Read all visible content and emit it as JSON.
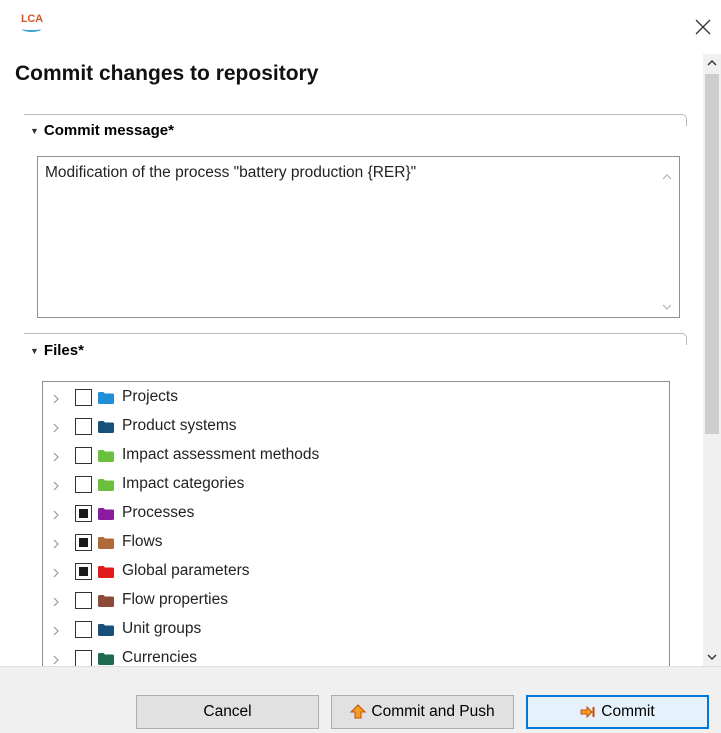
{
  "app": {
    "logo_text": "LCA"
  },
  "dialog": {
    "title": "Commit changes to repository"
  },
  "commit_message": {
    "header": "Commit message*",
    "value": "Modification of the process \"battery production {RER}\""
  },
  "files": {
    "header": "Files*",
    "items": [
      {
        "label": "Projects",
        "checked": "unchecked",
        "folder_color": "#1e90d8"
      },
      {
        "label": "Product systems",
        "checked": "unchecked",
        "folder_color": "#17507a"
      },
      {
        "label": "Impact assessment methods",
        "checked": "unchecked",
        "folder_color": "#6abf3c"
      },
      {
        "label": "Impact categories",
        "checked": "unchecked",
        "folder_color": "#6abf3c"
      },
      {
        "label": "Processes",
        "checked": "partial",
        "folder_color": "#8a1a9e"
      },
      {
        "label": "Flows",
        "checked": "partial",
        "folder_color": "#b06a3a"
      },
      {
        "label": "Global parameters",
        "checked": "partial",
        "folder_color": "#e01b1b"
      },
      {
        "label": "Flow properties",
        "checked": "unchecked",
        "folder_color": "#8b4a3a"
      },
      {
        "label": "Unit groups",
        "checked": "unchecked",
        "folder_color": "#17507a"
      },
      {
        "label": "Currencies",
        "checked": "unchecked",
        "folder_color": "#1c6b4e"
      }
    ]
  },
  "buttons": {
    "cancel": "Cancel",
    "commit_and_push": "Commit and Push",
    "commit": "Commit"
  }
}
